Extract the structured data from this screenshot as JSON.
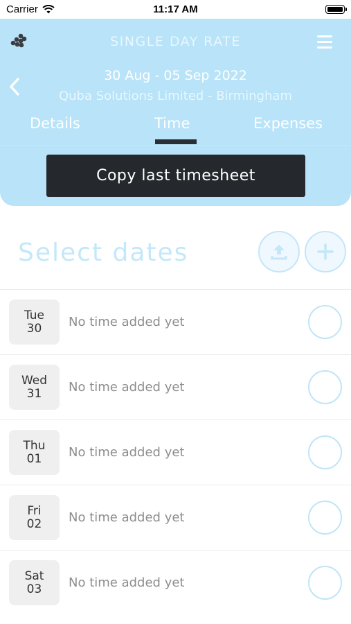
{
  "status_bar": {
    "carrier": "Carrier",
    "time": "11:17 AM"
  },
  "header": {
    "title": "SINGLE DAY RATE",
    "date_range": "30 Aug - 05 Sep 2022",
    "company": "Quba Solutions Limited - Birmingham",
    "tabs": [
      {
        "label": "Details",
        "active": false
      },
      {
        "label": "Time",
        "active": true
      },
      {
        "label": "Expenses",
        "active": false
      }
    ],
    "copy_button_label": "Copy last timesheet"
  },
  "select": {
    "title": "Select dates"
  },
  "days": [
    {
      "weekday": "Tue",
      "date": "30",
      "status": "No time added yet"
    },
    {
      "weekday": "Wed",
      "date": "31",
      "status": "No time added yet"
    },
    {
      "weekday": "Thu",
      "date": "01",
      "status": "No time added yet"
    },
    {
      "weekday": "Fri",
      "date": "02",
      "status": "No time added yet"
    },
    {
      "weekday": "Sat",
      "date": "03",
      "status": "No time added yet"
    }
  ],
  "colors": {
    "header_bg": "#b8e3f8",
    "accent": "#c3e8f9",
    "button_dark": "#25282d"
  }
}
